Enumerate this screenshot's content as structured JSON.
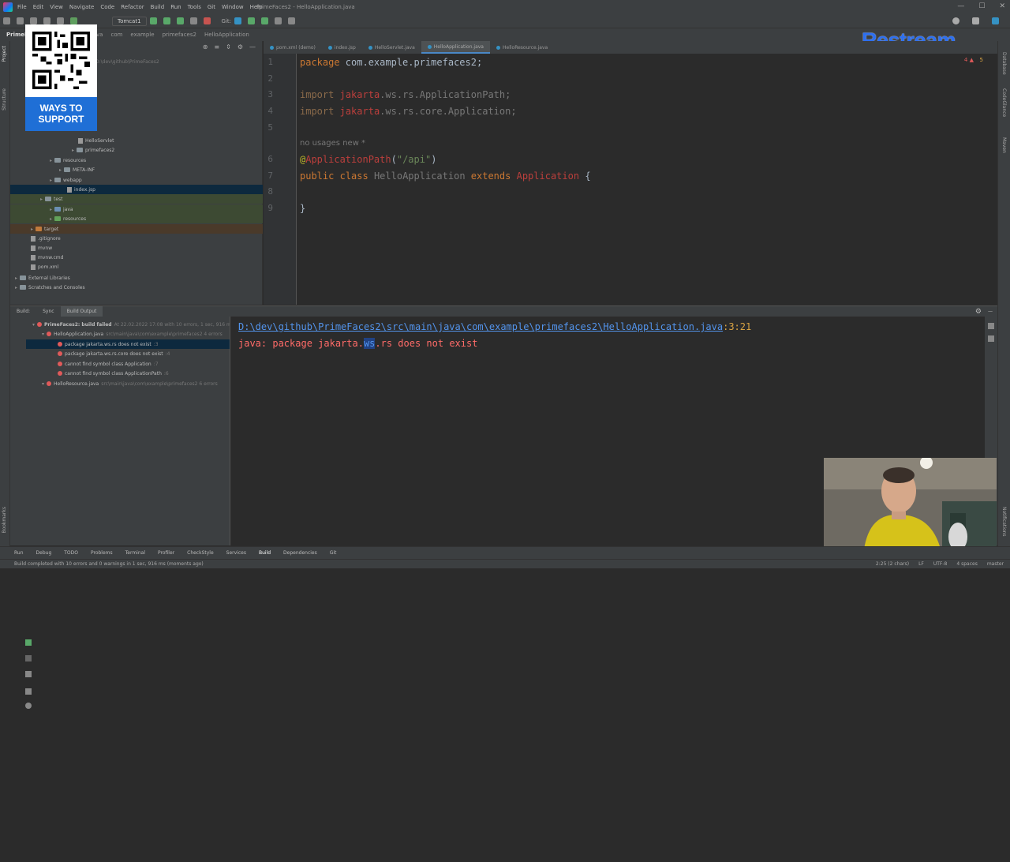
{
  "titlebar": {
    "menu": [
      "File",
      "Edit",
      "View",
      "Navigate",
      "Code",
      "Refactor",
      "Build",
      "Run",
      "Tools",
      "Git",
      "Window",
      "Help"
    ],
    "window_title": "PrimeFaces2 - HelloApplication.java"
  },
  "toolbar": {
    "run_config": "Tomcat1",
    "git_label": "Git:"
  },
  "breadcrumbs": [
    "PrimeFaces2",
    "src",
    "main",
    "java",
    "com",
    "example",
    "primefaces2",
    "HelloApplication"
  ],
  "project_tree": {
    "root_path": "D:\\dev\\github\\PrimeFaces2",
    "rows": [
      {
        "label": "HelloServlet",
        "type": "file"
      },
      {
        "label": "primefaces2",
        "type": "folder"
      },
      {
        "label": "resources",
        "type": "folder"
      },
      {
        "label": "META-INF",
        "type": "folder"
      },
      {
        "label": "webapp",
        "type": "folder"
      },
      {
        "label": "index.jsp",
        "type": "file"
      },
      {
        "label": "test",
        "type": "folder"
      },
      {
        "label": "java",
        "type": "folder"
      },
      {
        "label": "resources",
        "type": "folder"
      },
      {
        "label": "target",
        "type": "folder"
      },
      {
        "label": ".gitignore",
        "type": "file"
      },
      {
        "label": "mvnw",
        "type": "file"
      },
      {
        "label": "mvnw.cmd",
        "type": "file"
      },
      {
        "label": "pom.xml",
        "type": "file"
      },
      {
        "label": "External Libraries",
        "type": "folder"
      },
      {
        "label": "Scratches and Consoles",
        "type": "folder"
      }
    ]
  },
  "overlay": {
    "qr_label_1": "WAYS TO",
    "qr_label_2": "SUPPORT",
    "restream": "Restream"
  },
  "editor": {
    "tabs": [
      "pom.xml (demo)",
      "index.jsp",
      "HelloServlet.java",
      "HelloApplication.java",
      "HelloResource.java"
    ],
    "active_tab": "HelloApplication.java",
    "inspection": {
      "errors": "4",
      "warnings": "5"
    },
    "line_numbers": [
      "1",
      "2",
      "3",
      "4",
      "5",
      "6",
      "7",
      "8",
      "9"
    ],
    "hint": "no usages   new *",
    "code": {
      "l1_kw": "package",
      "l1_rest": " com.example.primefaces2;",
      "l3_kw": "import",
      "l3_pkg": "jakarta",
      "l3_rest": ".ws.rs.ApplicationPath;",
      "l4_kw": "import",
      "l4_pkg": "jakarta",
      "l4_rest": ".ws.rs.core.Application;",
      "l6_at": "@",
      "l6_ann": "ApplicationPath",
      "l6_open": "(",
      "l6_str": "\"/api\"",
      "l6_close": ")",
      "l7_public": "public",
      "l7_class": "class",
      "l7_name": "HelloApplication",
      "l7_extends": "extends",
      "l7_super": "Application",
      "l7_brace": "{",
      "l9": "}"
    }
  },
  "build": {
    "tabs": [
      "Build:",
      "Sync",
      "Build Output"
    ],
    "tree": [
      {
        "label": "PrimeFaces2: build failed",
        "detail": "At 22.02.2022 17:08 with 10 errors, 1 sec, 916 ms"
      },
      {
        "label": "HelloApplication.java",
        "detail": "src\\main\\java\\com\\example\\primefaces2 4 errors"
      },
      {
        "label": "package jakarta.ws.rs does not exist",
        "detail": ":3"
      },
      {
        "label": "package jakarta.ws.rs.core does not exist",
        "detail": ":4"
      },
      {
        "label": "cannot find symbol class Application",
        "detail": ":7"
      },
      {
        "label": "cannot find symbol class ApplicationPath",
        "detail": ":6"
      },
      {
        "label": "HelloResource.java",
        "detail": "src\\main\\java\\com\\example\\primefaces2 6 errors"
      }
    ],
    "output_path": "D:\\dev\\github\\PrimeFaces2\\src\\main\\java\\com\\example\\primefaces2\\HelloApplication.java",
    "output_pos": ":3:21",
    "err_pre": "java: package jakarta.",
    "err_sel": "ws",
    "err_post": ".rs does not exist"
  },
  "toolstrip": [
    "Run",
    "Debug",
    "TODO",
    "Problems",
    "Terminal",
    "Profiler",
    "CheckStyle",
    "Services",
    "Build",
    "Dependencies",
    "Git"
  ],
  "statusbar": {
    "message": "Build completed with 10 errors and 0 warnings in 1 sec, 916 ms (moments ago)",
    "right": [
      "2:25 (2 chars)",
      "LF",
      "UTF-8",
      "4 spaces",
      "master"
    ]
  }
}
